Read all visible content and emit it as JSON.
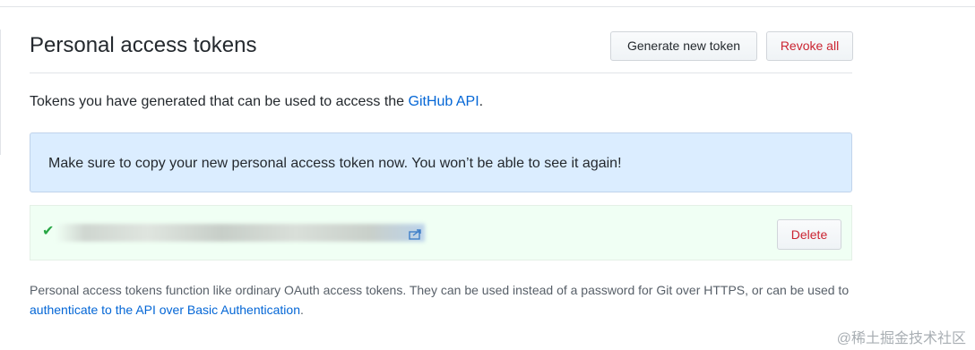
{
  "header": {
    "title": "Personal access tokens",
    "generate_label": "Generate new token",
    "revoke_label": "Revoke all"
  },
  "intro": {
    "text": "Tokens you have generated that can be used to access the ",
    "link": "GitHub API",
    "suffix": "."
  },
  "flash": {
    "message": "Make sure to copy your new personal access token now. You won’t be able to see it again!"
  },
  "token": {
    "status_icon": "check-icon",
    "copy_icon": "clipboard-icon",
    "delete_label": "Delete"
  },
  "note": {
    "text": "Personal access tokens function like ordinary OAuth access tokens. They can be used instead of a password for Git over HTTPS, or can be used to ",
    "link": "authenticate to the API over Basic Authentication",
    "suffix": "."
  },
  "watermark": "@稀土掘金技术社区",
  "colors": {
    "link": "#0366d6",
    "danger": "#cb2431",
    "success": "#28a745",
    "flash_bg": "#dbedff",
    "token_bg": "#f0fff4"
  }
}
